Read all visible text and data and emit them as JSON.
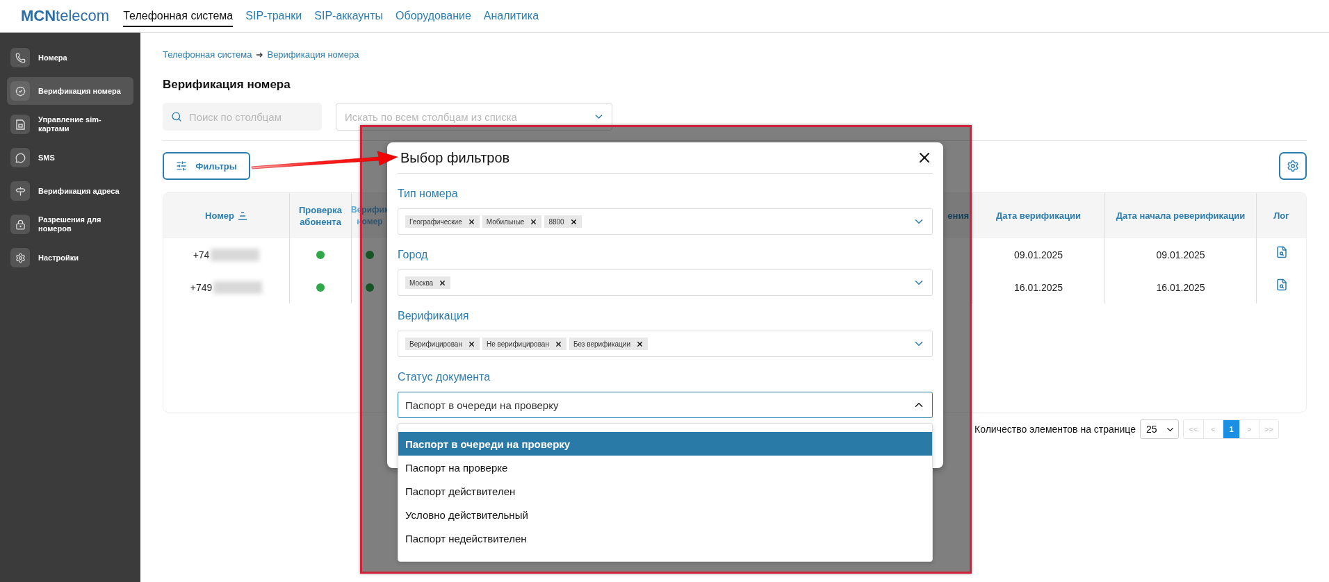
{
  "header": {
    "logo": {
      "bold": "MCN",
      "rest": "telecom"
    },
    "nav": [
      {
        "label": "Телефонная система",
        "selected": true
      },
      {
        "label": "SIP-транки",
        "selected": false
      },
      {
        "label": "SIP-аккаунты",
        "selected": false
      },
      {
        "label": "Оборудование",
        "selected": false
      },
      {
        "label": "Аналитика",
        "selected": false
      }
    ]
  },
  "sidebar": {
    "items": [
      {
        "label": "Номера",
        "kind": "phone",
        "selected": false
      },
      {
        "label": "Верификация номера",
        "kind": "verify",
        "selected": true
      },
      {
        "label": "Управление sim-картами",
        "kind": "sim",
        "selected": false
      },
      {
        "label": "SMS",
        "kind": "sms",
        "selected": false
      },
      {
        "label": "Верификация адреса",
        "kind": "address",
        "selected": false
      },
      {
        "label": "Разрешения для номеров",
        "kind": "permission",
        "selected": false
      },
      {
        "label": "Настройки",
        "kind": "settings",
        "selected": false
      }
    ]
  },
  "breadcrumb": [
    "Телефонная система",
    "Верификация номера"
  ],
  "page_title": "Верификация номера",
  "search": {
    "placeholder": "Поиск по столбцам"
  },
  "column_select": {
    "placeholder": "Искать по всем столбцам из списка"
  },
  "filters_button": "Фильтры",
  "table": {
    "columns": [
      {
        "label": "Номер",
        "sortable": true
      },
      {
        "label": "Проверка абонента",
        "sortable": false
      },
      {
        "label": "Верифик номер",
        "sortable": false
      },
      {
        "label": "ения",
        "sortable": false
      },
      {
        "label": "Дата верификации",
        "sortable": false
      },
      {
        "label": "Дата начала реверификации",
        "sortable": false
      },
      {
        "label": "Лог",
        "sortable": false
      }
    ],
    "rows": [
      {
        "number": "+74",
        "subscriber_check": true,
        "number_verified": true,
        "verification_date": "09.01.2025",
        "reverification_date": "09.01.2025"
      },
      {
        "number": "+749",
        "subscriber_check": true,
        "number_verified": true,
        "verification_date": "16.01.2025",
        "reverification_date": "16.01.2025"
      }
    ]
  },
  "pagination": {
    "label": "Количество элементов на странице",
    "page_size": "25",
    "pages": [
      {
        "label": "<<",
        "selected": false,
        "disabled": true
      },
      {
        "label": "<",
        "selected": false,
        "disabled": true
      },
      {
        "label": "1",
        "selected": true,
        "disabled": false
      },
      {
        "label": ">",
        "selected": false,
        "disabled": true
      },
      {
        "label": ">>",
        "selected": false,
        "disabled": true
      }
    ]
  },
  "modal": {
    "title": "Выбор фильтров",
    "filters": [
      {
        "label": "Тип номера",
        "kind": "multi",
        "chips": [
          "Географические",
          "Мобильные",
          "8800"
        ]
      },
      {
        "label": "Город",
        "kind": "multi",
        "chips": [
          "Москва"
        ]
      },
      {
        "label": "Верификация",
        "kind": "multi",
        "chips": [
          "Верифицирован",
          "Не верифицирован",
          "Без верификации"
        ]
      },
      {
        "label": "Статус документа",
        "kind": "single",
        "value": "Паспорт в очереди на проверку",
        "expanded": true
      }
    ],
    "options": [
      {
        "label": "Паспорт в очереди на проверку",
        "selected": true
      },
      {
        "label": "Паспорт на проверке",
        "selected": false
      },
      {
        "label": "Паспорт действителен",
        "selected": false
      },
      {
        "label": "Условно действительный",
        "selected": false
      },
      {
        "label": "Паспорт недействителен",
        "selected": false
      }
    ]
  }
}
